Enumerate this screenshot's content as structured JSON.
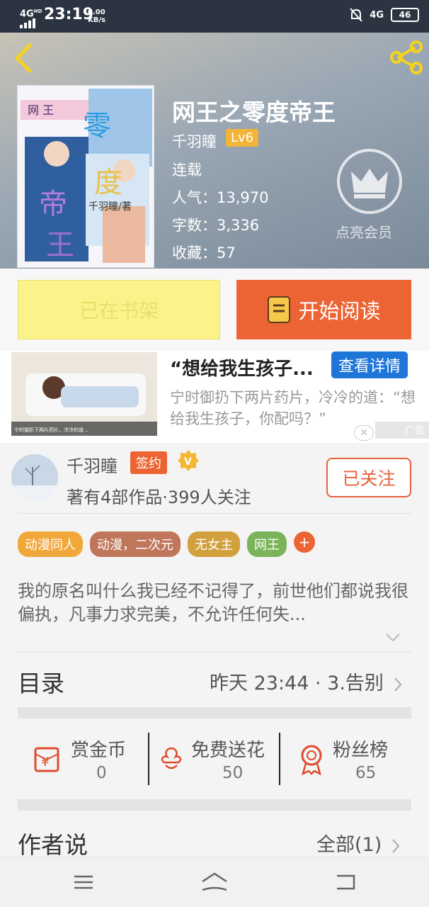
{
  "status_bar": {
    "network": "4G",
    "network_sub": "HD",
    "time": "23:19",
    "speed_value": "0.00",
    "speed_unit": "KB/s",
    "right_network": "4G",
    "battery": "46"
  },
  "book": {
    "title": "网王之零度帝王",
    "author": "千羽瞳",
    "level": "Lv6",
    "status": "连载",
    "popularity": "人气：13,970",
    "word_count": "字数：3,336",
    "favorites": "收藏：57",
    "vip_label": "点亮会员"
  },
  "buttons": {
    "shelf": "已在书架",
    "read": "开始阅读"
  },
  "ad": {
    "title": "“想给我生孩子...",
    "detail_button": "查看详情",
    "description": "宁时御扔下两片药片，冷冷的道：“想给我生孩子，你配吗？”",
    "tag": "广告",
    "image_caption": "宁时御扔下两片药片，冷冷的道：“想给我生孩子，你配吗？”"
  },
  "author_info": {
    "name": "千羽瞳",
    "sign_badge": "签约",
    "v_badge": "V",
    "stats": "著有4部作品·399人关注",
    "follow_button": "已关注"
  },
  "tags": [
    {
      "label": "动漫同人",
      "color": "#f2a73a"
    },
    {
      "label": "动漫，二次元",
      "color": "#c0765a"
    },
    {
      "label": "无女主",
      "color": "#d2a03c"
    },
    {
      "label": "网王",
      "color": "#7bb35a"
    }
  ],
  "tag_more": "+",
  "description": "我的原名叫什么我已经不记得了，前世他们都说我很偏执，凡事力求完美，不允许任何失...",
  "toc": {
    "label": "目录",
    "latest": "昨天 23:44 · 3.告别"
  },
  "stats": [
    {
      "label": "赏金币",
      "value": "0"
    },
    {
      "label": "免费送花",
      "value": "50"
    },
    {
      "label": "粉丝榜",
      "value": "65"
    }
  ],
  "author_say": {
    "label": "作者说",
    "all": "全部(1)"
  },
  "colors": {
    "accent": "#ec6433",
    "shelf_bg": "#fbf38a",
    "ad_blue": "#1e76d9",
    "tag_v": "#f2a73a"
  }
}
